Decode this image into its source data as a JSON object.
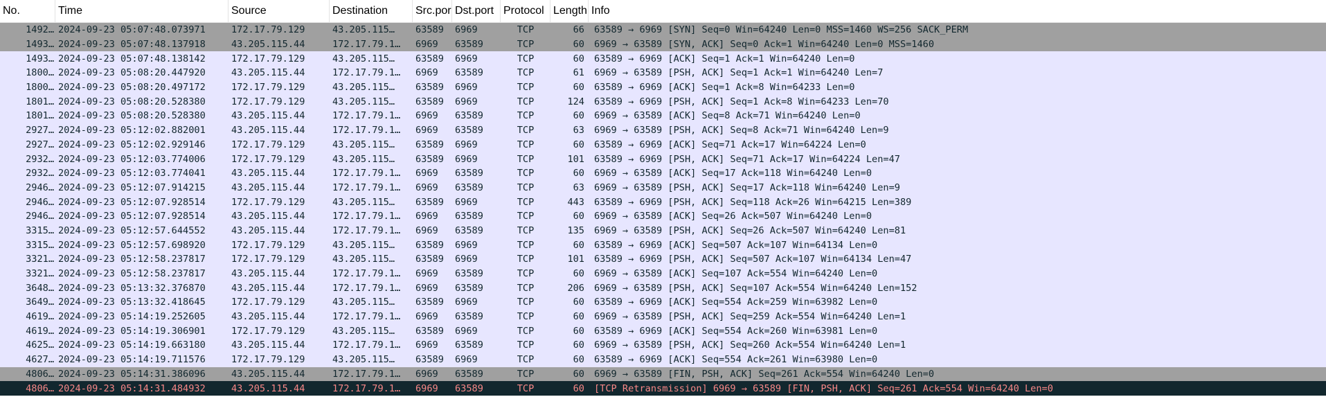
{
  "columns": {
    "no": "No.",
    "time": "Time",
    "source": "Source",
    "destination": "Destination",
    "src_port": "Src.por",
    "dst_port": "Dst.port",
    "protocol": "Protocol",
    "length": "Length",
    "info": "Info"
  },
  "colors": {
    "tcp_row_bg": "#e7e6ff",
    "handshake_row_bg": "#a0a0a0",
    "bad_tcp_bg": "#12272e",
    "bad_tcp_fg": "#f78787"
  },
  "packets": [
    {
      "no": "1492…",
      "time": "2024-09-23 05:07:48.073971",
      "source": "172.17.79.129",
      "destination": "43.205.115…",
      "src_port": "63589",
      "dst_port": "6969",
      "protocol": "TCP",
      "length": "66",
      "info": "63589 → 6969 [SYN] Seq=0 Win=64240 Len=0 MSS=1460 WS=256 SACK_PERM",
      "style": "handshake"
    },
    {
      "no": "1493…",
      "time": "2024-09-23 05:07:48.137918",
      "source": "43.205.115.44",
      "destination": "172.17.79.1…",
      "src_port": "6969",
      "dst_port": "63589",
      "protocol": "TCP",
      "length": "60",
      "info": "6969 → 63589 [SYN, ACK] Seq=0 Ack=1 Win=64240 Len=0 MSS=1460",
      "style": "handshake"
    },
    {
      "no": "1493…",
      "time": "2024-09-23 05:07:48.138142",
      "source": "172.17.79.129",
      "destination": "43.205.115…",
      "src_port": "63589",
      "dst_port": "6969",
      "protocol": "TCP",
      "length": "60",
      "info": "63589 → 6969 [ACK] Seq=1 Ack=1 Win=64240 Len=0",
      "style": "tcp"
    },
    {
      "no": "1800…",
      "time": "2024-09-23 05:08:20.447920",
      "source": "43.205.115.44",
      "destination": "172.17.79.1…",
      "src_port": "6969",
      "dst_port": "63589",
      "protocol": "TCP",
      "length": "61",
      "info": "6969 → 63589 [PSH, ACK] Seq=1 Ack=1 Win=64240 Len=7",
      "style": "tcp"
    },
    {
      "no": "1800…",
      "time": "2024-09-23 05:08:20.497172",
      "source": "172.17.79.129",
      "destination": "43.205.115…",
      "src_port": "63589",
      "dst_port": "6969",
      "protocol": "TCP",
      "length": "60",
      "info": "63589 → 6969 [ACK] Seq=1 Ack=8 Win=64233 Len=0",
      "style": "tcp"
    },
    {
      "no": "1801…",
      "time": "2024-09-23 05:08:20.528380",
      "source": "172.17.79.129",
      "destination": "43.205.115…",
      "src_port": "63589",
      "dst_port": "6969",
      "protocol": "TCP",
      "length": "124",
      "info": "63589 → 6969 [PSH, ACK] Seq=1 Ack=8 Win=64233 Len=70",
      "style": "tcp"
    },
    {
      "no": "1801…",
      "time": "2024-09-23 05:08:20.528380",
      "source": "43.205.115.44",
      "destination": "172.17.79.1…",
      "src_port": "6969",
      "dst_port": "63589",
      "protocol": "TCP",
      "length": "60",
      "info": "6969 → 63589 [ACK] Seq=8 Ack=71 Win=64240 Len=0",
      "style": "tcp"
    },
    {
      "no": "2927…",
      "time": "2024-09-23 05:12:02.882001",
      "source": "43.205.115.44",
      "destination": "172.17.79.1…",
      "src_port": "6969",
      "dst_port": "63589",
      "protocol": "TCP",
      "length": "63",
      "info": "6969 → 63589 [PSH, ACK] Seq=8 Ack=71 Win=64240 Len=9",
      "style": "tcp"
    },
    {
      "no": "2927…",
      "time": "2024-09-23 05:12:02.929146",
      "source": "172.17.79.129",
      "destination": "43.205.115…",
      "src_port": "63589",
      "dst_port": "6969",
      "protocol": "TCP",
      "length": "60",
      "info": "63589 → 6969 [ACK] Seq=71 Ack=17 Win=64224 Len=0",
      "style": "tcp"
    },
    {
      "no": "2932…",
      "time": "2024-09-23 05:12:03.774006",
      "source": "172.17.79.129",
      "destination": "43.205.115…",
      "src_port": "63589",
      "dst_port": "6969",
      "protocol": "TCP",
      "length": "101",
      "info": "63589 → 6969 [PSH, ACK] Seq=71 Ack=17 Win=64224 Len=47",
      "style": "tcp"
    },
    {
      "no": "2932…",
      "time": "2024-09-23 05:12:03.774041",
      "source": "43.205.115.44",
      "destination": "172.17.79.1…",
      "src_port": "6969",
      "dst_port": "63589",
      "protocol": "TCP",
      "length": "60",
      "info": "6969 → 63589 [ACK] Seq=17 Ack=118 Win=64240 Len=0",
      "style": "tcp"
    },
    {
      "no": "2946…",
      "time": "2024-09-23 05:12:07.914215",
      "source": "43.205.115.44",
      "destination": "172.17.79.1…",
      "src_port": "6969",
      "dst_port": "63589",
      "protocol": "TCP",
      "length": "63",
      "info": "6969 → 63589 [PSH, ACK] Seq=17 Ack=118 Win=64240 Len=9",
      "style": "tcp"
    },
    {
      "no": "2946…",
      "time": "2024-09-23 05:12:07.928514",
      "source": "172.17.79.129",
      "destination": "43.205.115…",
      "src_port": "63589",
      "dst_port": "6969",
      "protocol": "TCP",
      "length": "443",
      "info": "63589 → 6969 [PSH, ACK] Seq=118 Ack=26 Win=64215 Len=389",
      "style": "tcp"
    },
    {
      "no": "2946…",
      "time": "2024-09-23 05:12:07.928514",
      "source": "43.205.115.44",
      "destination": "172.17.79.1…",
      "src_port": "6969",
      "dst_port": "63589",
      "protocol": "TCP",
      "length": "60",
      "info": "6969 → 63589 [ACK] Seq=26 Ack=507 Win=64240 Len=0",
      "style": "tcp"
    },
    {
      "no": "3315…",
      "time": "2024-09-23 05:12:57.644552",
      "source": "43.205.115.44",
      "destination": "172.17.79.1…",
      "src_port": "6969",
      "dst_port": "63589",
      "protocol": "TCP",
      "length": "135",
      "info": "6969 → 63589 [PSH, ACK] Seq=26 Ack=507 Win=64240 Len=81",
      "style": "tcp"
    },
    {
      "no": "3315…",
      "time": "2024-09-23 05:12:57.698920",
      "source": "172.17.79.129",
      "destination": "43.205.115…",
      "src_port": "63589",
      "dst_port": "6969",
      "protocol": "TCP",
      "length": "60",
      "info": "63589 → 6969 [ACK] Seq=507 Ack=107 Win=64134 Len=0",
      "style": "tcp"
    },
    {
      "no": "3321…",
      "time": "2024-09-23 05:12:58.237817",
      "source": "172.17.79.129",
      "destination": "43.205.115…",
      "src_port": "63589",
      "dst_port": "6969",
      "protocol": "TCP",
      "length": "101",
      "info": "63589 → 6969 [PSH, ACK] Seq=507 Ack=107 Win=64134 Len=47",
      "style": "tcp"
    },
    {
      "no": "3321…",
      "time": "2024-09-23 05:12:58.237817",
      "source": "43.205.115.44",
      "destination": "172.17.79.1…",
      "src_port": "6969",
      "dst_port": "63589",
      "protocol": "TCP",
      "length": "60",
      "info": "6969 → 63589 [ACK] Seq=107 Ack=554 Win=64240 Len=0",
      "style": "tcp"
    },
    {
      "no": "3648…",
      "time": "2024-09-23 05:13:32.376870",
      "source": "43.205.115.44",
      "destination": "172.17.79.1…",
      "src_port": "6969",
      "dst_port": "63589",
      "protocol": "TCP",
      "length": "206",
      "info": "6969 → 63589 [PSH, ACK] Seq=107 Ack=554 Win=64240 Len=152",
      "style": "tcp"
    },
    {
      "no": "3649…",
      "time": "2024-09-23 05:13:32.418645",
      "source": "172.17.79.129",
      "destination": "43.205.115…",
      "src_port": "63589",
      "dst_port": "6969",
      "protocol": "TCP",
      "length": "60",
      "info": "63589 → 6969 [ACK] Seq=554 Ack=259 Win=63982 Len=0",
      "style": "tcp"
    },
    {
      "no": "4619…",
      "time": "2024-09-23 05:14:19.252605",
      "source": "43.205.115.44",
      "destination": "172.17.79.1…",
      "src_port": "6969",
      "dst_port": "63589",
      "protocol": "TCP",
      "length": "60",
      "info": "6969 → 63589 [PSH, ACK] Seq=259 Ack=554 Win=64240 Len=1",
      "style": "tcp"
    },
    {
      "no": "4619…",
      "time": "2024-09-23 05:14:19.306901",
      "source": "172.17.79.129",
      "destination": "43.205.115…",
      "src_port": "63589",
      "dst_port": "6969",
      "protocol": "TCP",
      "length": "60",
      "info": "63589 → 6969 [ACK] Seq=554 Ack=260 Win=63981 Len=0",
      "style": "tcp"
    },
    {
      "no": "4625…",
      "time": "2024-09-23 05:14:19.663180",
      "source": "43.205.115.44",
      "destination": "172.17.79.1…",
      "src_port": "6969",
      "dst_port": "63589",
      "protocol": "TCP",
      "length": "60",
      "info": "6969 → 63589 [PSH, ACK] Seq=260 Ack=554 Win=64240 Len=1",
      "style": "tcp"
    },
    {
      "no": "4627…",
      "time": "2024-09-23 05:14:19.711576",
      "source": "172.17.79.129",
      "destination": "43.205.115…",
      "src_port": "63589",
      "dst_port": "6969",
      "protocol": "TCP",
      "length": "60",
      "info": "63589 → 6969 [ACK] Seq=554 Ack=261 Win=63980 Len=0",
      "style": "tcp"
    },
    {
      "no": "4806…",
      "time": "2024-09-23 05:14:31.386096",
      "source": "43.205.115.44",
      "destination": "172.17.79.1…",
      "src_port": "6969",
      "dst_port": "63589",
      "protocol": "TCP",
      "length": "60",
      "info": "6969 → 63589 [FIN, PSH, ACK] Seq=261 Ack=554 Win=64240 Len=0",
      "style": "handshake"
    },
    {
      "no": "4806…",
      "time": "2024-09-23 05:14:31.484932",
      "source": "43.205.115.44",
      "destination": "172.17.79.1…",
      "src_port": "6969",
      "dst_port": "63589",
      "protocol": "TCP",
      "length": "60",
      "info": "[TCP Retransmission] 6969 → 63589 [FIN, PSH, ACK] Seq=261 Ack=554 Win=64240 Len=0",
      "style": "bad"
    }
  ]
}
